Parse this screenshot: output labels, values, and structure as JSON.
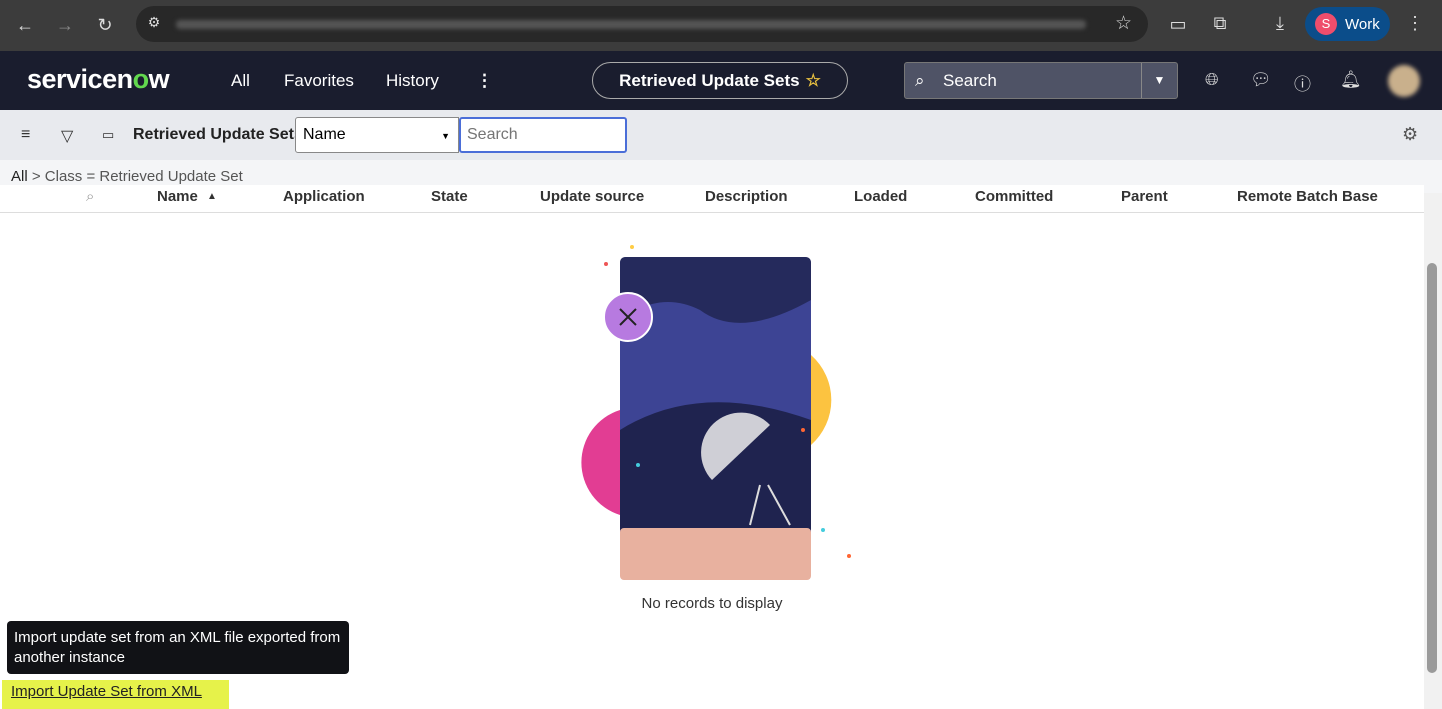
{
  "browser": {
    "profile_initial": "S",
    "profile_label": "Work"
  },
  "nav": {
    "logo_a": "servicen",
    "logo_b": "o",
    "logo_c": "w",
    "all": "All",
    "favorites": "Favorites",
    "history": "History",
    "more": "⋮",
    "page_title": "Retrieved Update Sets",
    "search_placeholder": "Search"
  },
  "toolbar": {
    "title": "Retrieved Update Sets",
    "field_select": "Name",
    "search_placeholder": "Search"
  },
  "breadcrumb": {
    "all": "All",
    "sep": ">",
    "filter": "Class = Retrieved Update Set"
  },
  "table": {
    "columns": [
      "Name",
      "Application",
      "State",
      "Update source",
      "Description",
      "Loaded",
      "Committed",
      "Parent",
      "Remote Batch Base"
    ],
    "sort_indicator": "▲",
    "empty_message": "No records to display"
  },
  "tooltip": "Import update set from an XML file exported from another instance",
  "import_link": "Import Update Set from XML"
}
